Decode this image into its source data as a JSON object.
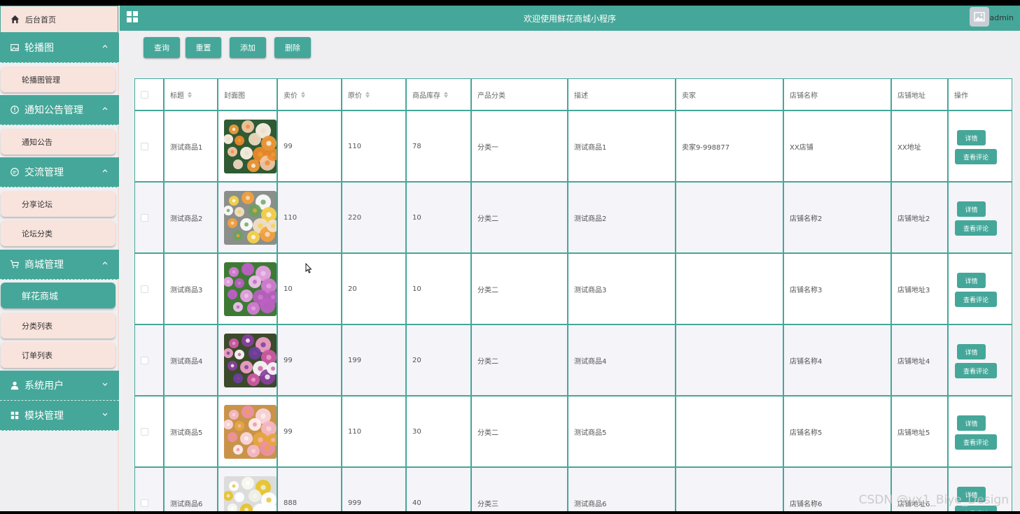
{
  "sidebar": {
    "home": "后台首页",
    "groups": [
      {
        "label": "轮播图",
        "icon": "image-icon",
        "items": [
          "轮播图管理"
        ]
      },
      {
        "label": "通知公告管理",
        "icon": "info-circle-icon",
        "items": [
          "通知公告"
        ]
      },
      {
        "label": "交流管理",
        "icon": "chat-icon",
        "items": [
          "分享论坛",
          "论坛分类"
        ]
      },
      {
        "label": "商城管理",
        "icon": "cart-icon",
        "items": [
          "鲜花商城",
          "分类列表",
          "订单列表"
        ]
      },
      {
        "label": "系统用户",
        "icon": "user-icon",
        "items": []
      },
      {
        "label": "模块管理",
        "icon": "grid-icon",
        "items": []
      }
    ],
    "active_item": "鲜花商城"
  },
  "header": {
    "title": "欢迎使用鲜花商城小程序",
    "user": "admin"
  },
  "toolbar": {
    "query": "查询",
    "reset": "重置",
    "add": "添加",
    "delete": "删除"
  },
  "table": {
    "columns": [
      "标题",
      "封面图",
      "卖价",
      "原价",
      "商品库存",
      "产品分类",
      "描述",
      "卖家",
      "店铺名称",
      "店铺地址",
      "操作"
    ],
    "rows": [
      {
        "title": "测试商品1",
        "price": "99",
        "orig": "110",
        "stock": "78",
        "category": "分类一",
        "desc": "测试商品1",
        "seller": "卖家9-998877",
        "shop": "XX店铺",
        "addr": "XX地址",
        "photo": "bouquet-orange"
      },
      {
        "title": "测试商品2",
        "price": "110",
        "orig": "220",
        "stock": "10",
        "category": "分类二",
        "desc": "测试商品2",
        "seller": "",
        "shop": "店铺名称2",
        "addr": "店铺地址2",
        "photo": "bouquet-yellow"
      },
      {
        "title": "测试商品3",
        "price": "10",
        "orig": "20",
        "stock": "10",
        "category": "分类二",
        "desc": "测试商品3",
        "seller": "",
        "shop": "店铺名称3",
        "addr": "店铺地址3",
        "photo": "cosmos-pink"
      },
      {
        "title": "测试商品4",
        "price": "99",
        "orig": "199",
        "stock": "20",
        "category": "分类二",
        "desc": "测试商品4",
        "seller": "",
        "shop": "店铺名称4",
        "addr": "店铺地址4",
        "photo": "hyacinth-mixed"
      },
      {
        "title": "测试商品5",
        "price": "99",
        "orig": "110",
        "stock": "30",
        "category": "分类二",
        "desc": "测试商品5",
        "seller": "",
        "shop": "店铺名称5",
        "addr": "店铺地址5",
        "photo": "pink-blossom"
      },
      {
        "title": "测试商品6",
        "price": "888",
        "orig": "999",
        "stock": "40",
        "category": "分类三",
        "desc": "测试商品6",
        "seller": "",
        "shop": "店铺名称6",
        "addr": "店铺地址6",
        "photo": "daisy-white"
      }
    ],
    "actions": {
      "detail": "详情",
      "reviews": "查看评论"
    }
  },
  "watermark": "CSDN @vx1_Biye_Design",
  "colors": {
    "accent": "#45a799",
    "sub_bg": "#f8e3dd",
    "page_bg": "#efeff2"
  }
}
